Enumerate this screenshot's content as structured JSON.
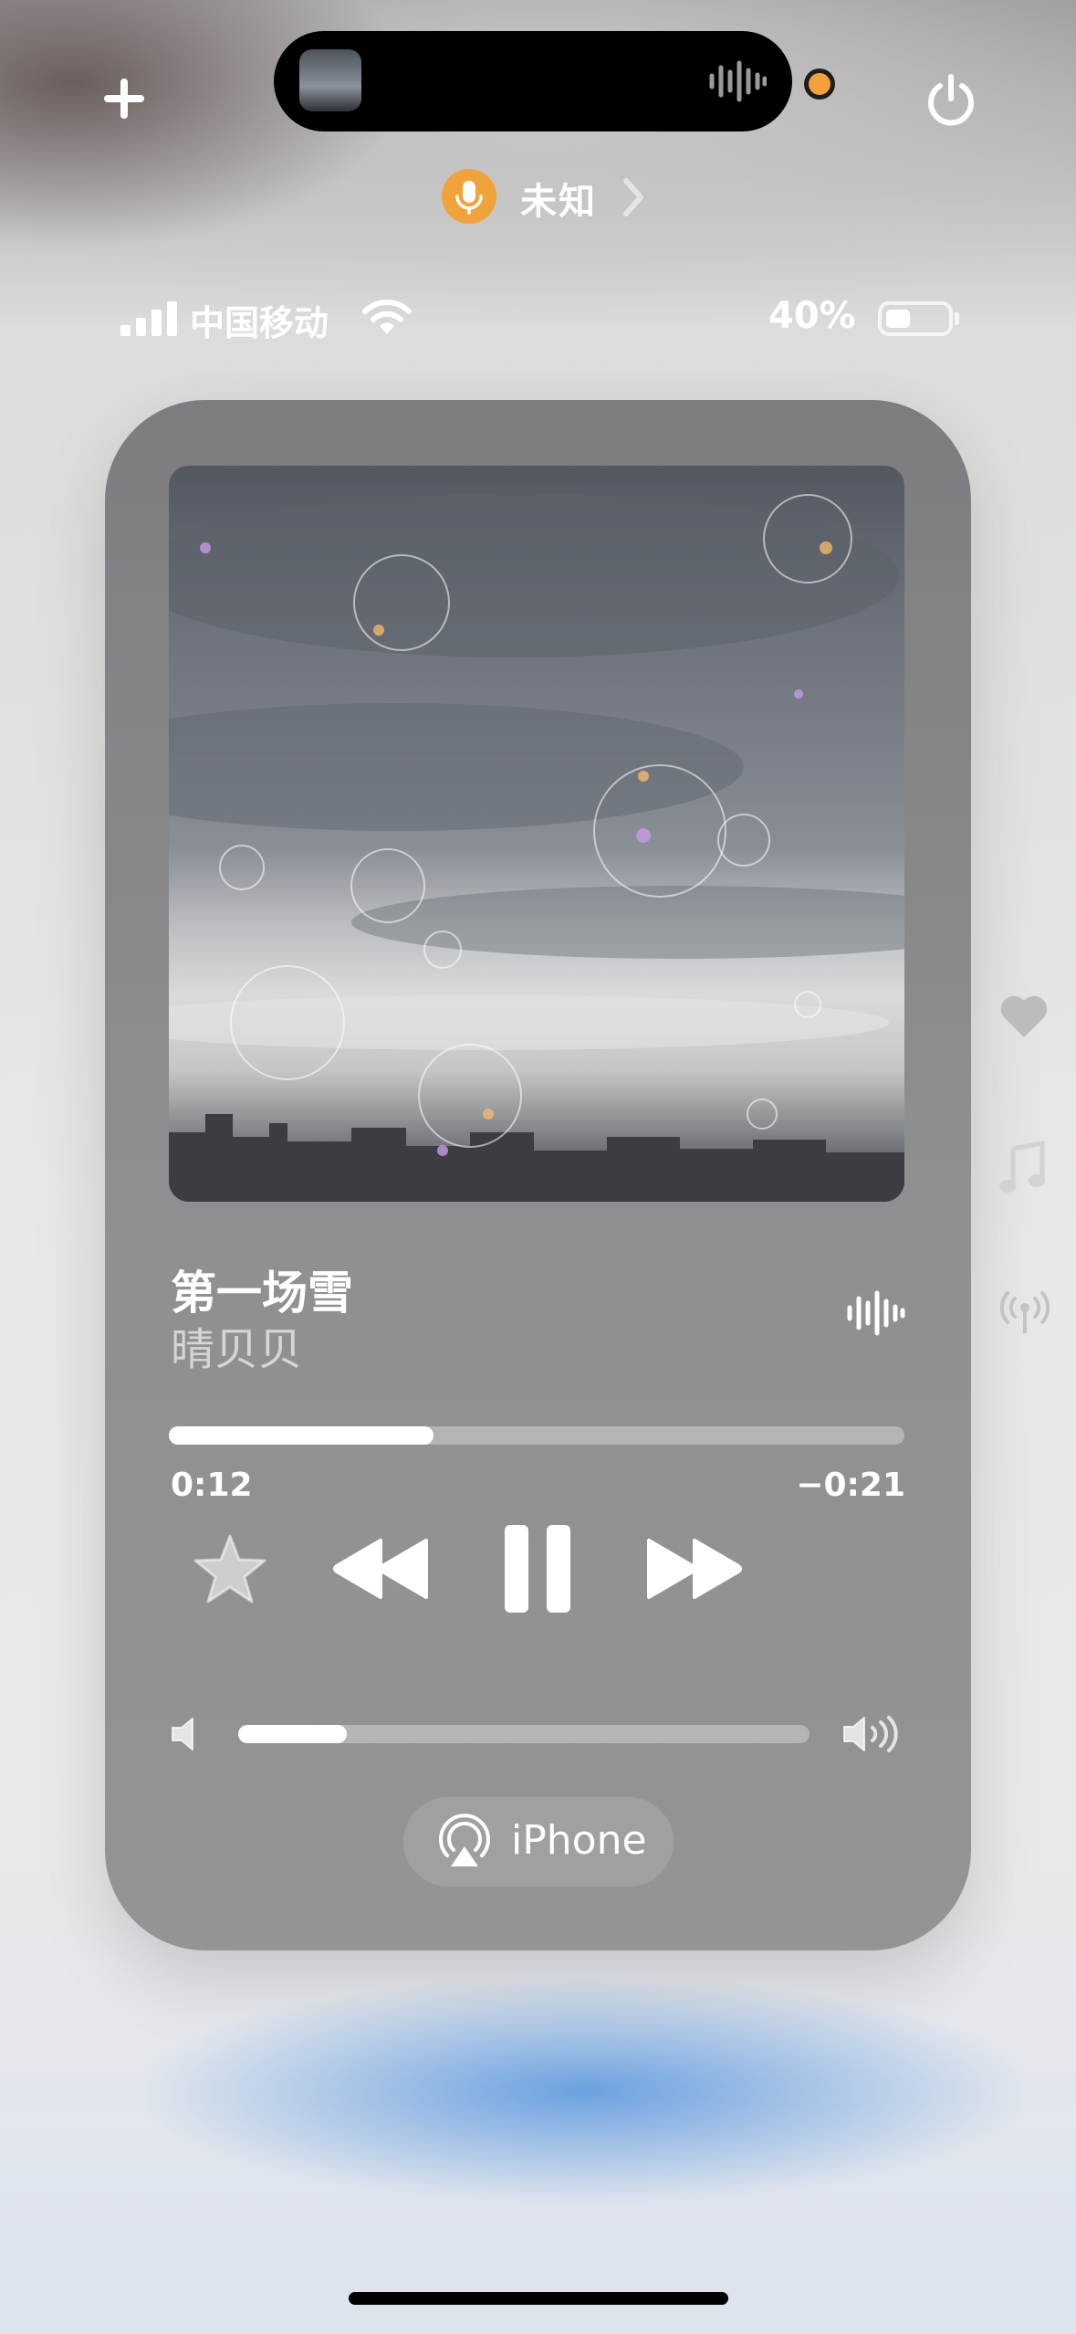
{
  "top_bar": {
    "add_icon": "plus-icon",
    "live_activity_icon": "waveform-icon",
    "power_icon": "power-icon",
    "recording_indicator_color": "#f4a13a"
  },
  "audio_source": {
    "label": "未知",
    "icon": "microphone-icon",
    "accent": "#f0a23b"
  },
  "status_bar": {
    "carrier": "中国移动",
    "battery_percent_label": "40%",
    "battery_level": 0.4,
    "signal_bars": 4
  },
  "now_playing": {
    "title": "第一场雪",
    "artist": "晴贝贝",
    "elapsed": "0:12",
    "remaining": "−0:21",
    "progress": 0.36,
    "volume": 0.19,
    "output_device": "iPhone"
  },
  "controls": {
    "favorite_icon": "star-icon",
    "rewind_icon": "rewind-icon",
    "pause_icon": "pause-icon",
    "forward_icon": "fast-forward-icon",
    "volume_low_icon": "speaker-low-icon",
    "volume_high_icon": "speaker-high-icon",
    "airplay_icon": "airplay-icon"
  },
  "side_rail": [
    "heart-icon",
    "music-note-icon",
    "broadcast-icon"
  ]
}
